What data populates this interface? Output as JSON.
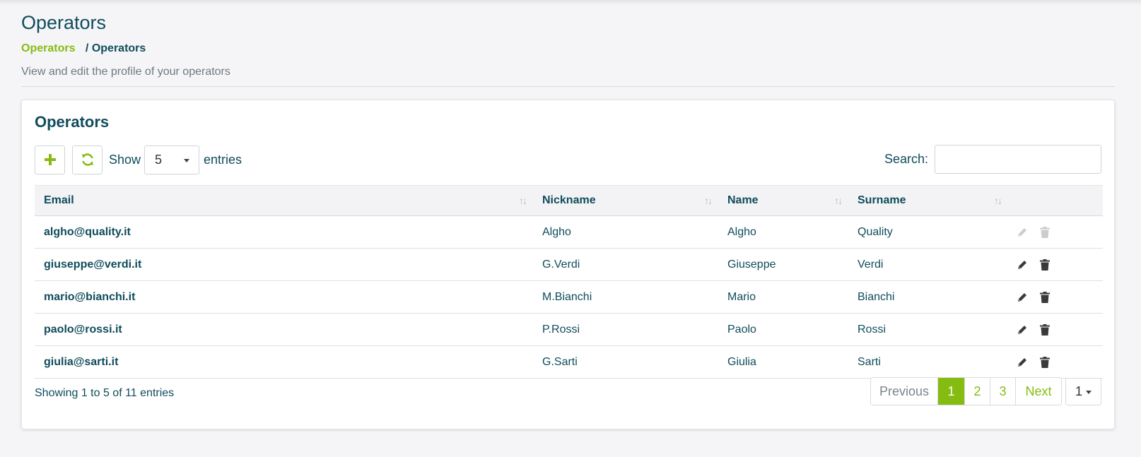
{
  "page": {
    "title": "Operators",
    "breadcrumb": {
      "link": "Operators",
      "separator": "/",
      "current": "Operators"
    },
    "subtitle": "View and edit the profile of your operators"
  },
  "card": {
    "title": "Operators",
    "toolbar": {
      "add_icon": "plus-icon",
      "refresh_icon": "refresh-icon",
      "show_label": "Show",
      "page_size": "5",
      "entries_label": "entries",
      "search_label": "Search:",
      "search_value": ""
    },
    "table": {
      "columns": [
        "Email",
        "Nickname",
        "Name",
        "Surname"
      ],
      "sort_glyph": "↑↓",
      "rows": [
        {
          "email": "algho@quality.it",
          "nickname": "Algho",
          "name": "Algho",
          "surname": "Quality",
          "actions_enabled": false
        },
        {
          "email": "giuseppe@verdi.it",
          "nickname": "G.Verdi",
          "name": "Giuseppe",
          "surname": "Verdi",
          "actions_enabled": true
        },
        {
          "email": "mario@bianchi.it",
          "nickname": "M.Bianchi",
          "name": "Mario",
          "surname": "Bianchi",
          "actions_enabled": true
        },
        {
          "email": "paolo@rossi.it",
          "nickname": "P.Rossi",
          "name": "Paolo",
          "surname": "Rossi",
          "actions_enabled": true
        },
        {
          "email": "giulia@sarti.it",
          "nickname": "G.Sarti",
          "name": "Giulia",
          "surname": "Sarti",
          "actions_enabled": true
        }
      ]
    },
    "footer": {
      "info": "Showing 1 to 5 of 11 entries",
      "pagination": {
        "previous": "Previous",
        "pages": [
          "1",
          "2",
          "3"
        ],
        "active_page": "1",
        "next": "Next",
        "page_select": "1"
      }
    }
  },
  "colors": {
    "accent": "#86bc12",
    "text": "#0f4c5c",
    "muted": "#6b7a80"
  }
}
